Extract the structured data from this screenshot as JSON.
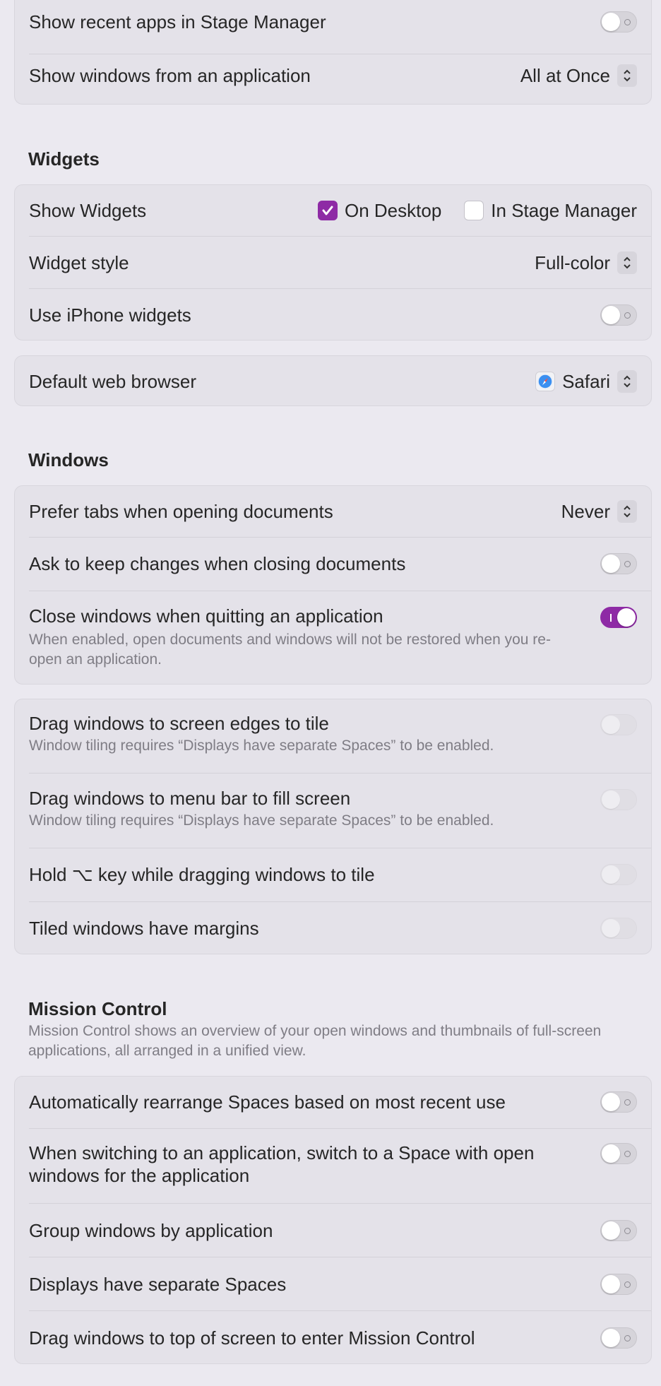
{
  "stage_manager": {
    "show_recent_apps": {
      "label": "Show recent apps in Stage Manager",
      "state": "off"
    },
    "show_windows": {
      "label": "Show windows from an application",
      "value": "All at Once"
    }
  },
  "widgets": {
    "heading": "Widgets",
    "show_widgets": {
      "label": "Show Widgets",
      "on_desktop": "On Desktop",
      "in_stage_manager": "In Stage Manager"
    },
    "widget_style": {
      "label": "Widget style",
      "value": "Full-color"
    },
    "iphone_widgets": {
      "label": "Use iPhone widgets",
      "state": "off"
    }
  },
  "browser": {
    "label": "Default web browser",
    "value": "Safari"
  },
  "windows": {
    "heading": "Windows",
    "prefer_tabs": {
      "label": "Prefer tabs when opening documents",
      "value": "Never"
    },
    "ask_keep_changes": {
      "label": "Ask to keep changes when closing documents",
      "state": "off"
    },
    "close_windows": {
      "label": "Close windows when quitting an application",
      "description": "When enabled, open documents and windows will not be restored when you re-open an application.",
      "state": "on"
    }
  },
  "tiling": {
    "drag_edges": {
      "label": "Drag windows to screen edges to tile",
      "description": "Window tiling requires “Displays have separate Spaces” to be enabled."
    },
    "drag_menubar": {
      "label": "Drag windows to menu bar to fill screen",
      "description": "Window tiling requires “Displays have separate Spaces” to be enabled."
    },
    "hold_key": {
      "label": "Hold ⌥ key while dragging windows to tile"
    },
    "margins": {
      "label": "Tiled windows have margins"
    }
  },
  "mission_control": {
    "heading": "Mission Control",
    "description": "Mission Control shows an overview of your open windows and thumbnails of full-screen applications, all arranged in a unified view.",
    "rearrange": {
      "label": "Automatically rearrange Spaces based on most recent use"
    },
    "switch_space": {
      "label": "When switching to an application, switch to a Space with open windows for the application"
    },
    "group_by_app": {
      "label": "Group windows by application"
    },
    "separate_spaces": {
      "label": "Displays have separate Spaces"
    },
    "drag_top": {
      "label": "Drag windows to top of screen to enter Mission Control"
    }
  },
  "colors": {
    "accent": "#8e2aa5",
    "background": "#ebe9f0",
    "group_background": "#e4e2e9"
  }
}
